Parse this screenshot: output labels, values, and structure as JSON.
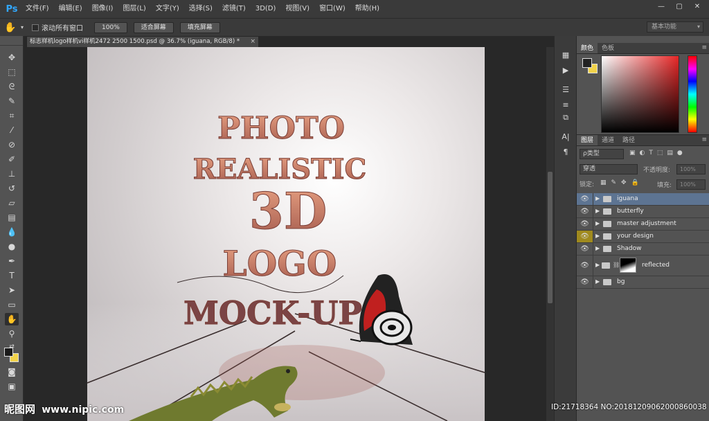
{
  "app": {
    "logo": "Ps",
    "menu": [
      "文件(F)",
      "编辑(E)",
      "图像(I)",
      "图层(L)",
      "文字(Y)",
      "选择(S)",
      "滤镜(T)",
      "3D(D)",
      "视图(V)",
      "窗口(W)",
      "帮助(H)"
    ],
    "window_controls": {
      "minimize": "—",
      "restore": "▢",
      "close": "✕"
    }
  },
  "options": {
    "tool_icon": "hand-icon",
    "scroll_all_label": "滚动所有窗口",
    "btn_100": "100%",
    "btn_fit": "适合屏幕",
    "btn_fill": "填充屏幕",
    "workspace": "基本功能"
  },
  "document": {
    "tab_title": "标志样机logo样机vi样机2472 2500 1500.psd @ 36.7% (iguana, RGB/8) *",
    "close": "×"
  },
  "artwork": {
    "line1": "PHOTO",
    "line2": "REALISTIC",
    "line3": "3D",
    "line4": "LOGO",
    "line5": "MOCK-UP"
  },
  "watermark": {
    "left_cn": "昵图网",
    "left_url": "www.nipic.com",
    "right": "ID:21718364 NO:20181209062000860038"
  },
  "panels": {
    "color_tabs": [
      "颜色",
      "色板"
    ],
    "layer_tabs": [
      "图层",
      "通道",
      "路径"
    ],
    "filter_kind": "ρ类型",
    "blend_mode": "穿透",
    "opacity_label": "不透明度:",
    "opacity_value": "100%",
    "lock_label": "锁定:",
    "fill_label": "填充:",
    "fill_value": "100%",
    "panel_menu": "≡",
    "collapse": "◂◂"
  },
  "layers": [
    {
      "name": "iguana",
      "selected": true
    },
    {
      "name": "butterfly",
      "selected": false
    },
    {
      "name": "master adjustment",
      "selected": false
    },
    {
      "name": "your design",
      "selected": false
    },
    {
      "name": "Shadow",
      "selected": false
    },
    {
      "name": "reflected",
      "selected": false
    },
    {
      "name": "bg",
      "selected": false
    }
  ],
  "colors": {
    "accent_selected": "#5d7492",
    "foreground": "#1a1a1a",
    "background": "#f1d34a",
    "eye_highlight": "#a08a1e"
  }
}
